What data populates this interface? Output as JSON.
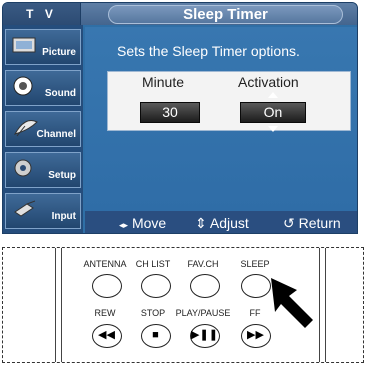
{
  "osd": {
    "tv_label": "T V",
    "menu_title": "Sleep Timer",
    "sidebar": [
      {
        "label": "Picture"
      },
      {
        "label": "Sound"
      },
      {
        "label": "Channel"
      },
      {
        "label": "Setup"
      },
      {
        "label": "Input"
      }
    ],
    "description": "Sets the Sleep Timer options.",
    "columns": {
      "minute": "Minute",
      "activation": "Activation"
    },
    "values": {
      "minute": "30",
      "activation": "On"
    },
    "footer": {
      "move": "Move",
      "adjust": "Adjust",
      "return": "Return"
    }
  },
  "remote": {
    "row1": [
      "ANTENNA",
      "CH LIST",
      "FAV.CH",
      "SLEEP"
    ],
    "row2": [
      "REW",
      "STOP",
      "PLAY/PAUSE",
      "FF"
    ]
  }
}
